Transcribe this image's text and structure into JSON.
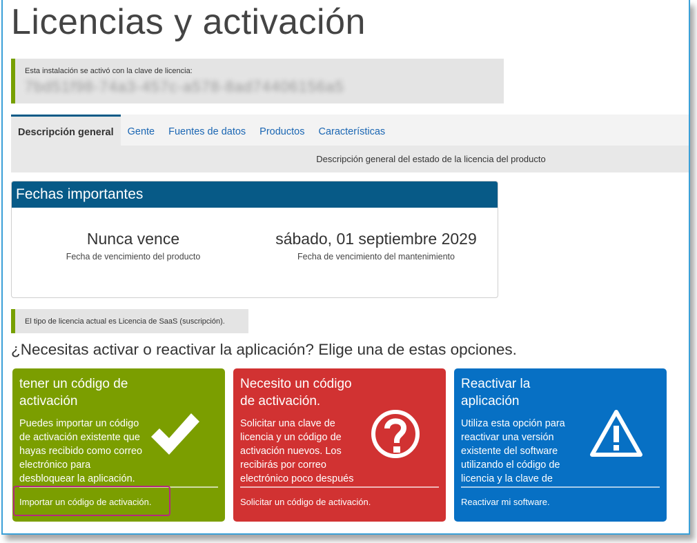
{
  "page": {
    "title": "Licencias y activación"
  },
  "license": {
    "label": "Esta instalación se activó con la clave de licencia:",
    "key": "7bd51f98-74a3-457c-a578-8ad74406156a5"
  },
  "tabs": [
    {
      "label": "Descripción general",
      "active": true
    },
    {
      "label": "Gente"
    },
    {
      "label": "Fuentes de datos"
    },
    {
      "label": "Productos"
    },
    {
      "label": "Características"
    }
  ],
  "tab_description": "Descripción general del estado de la licencia del producto",
  "dates": {
    "header": "Fechas importantes",
    "product_expiry_value": "Nunca vence",
    "product_expiry_label": "Fecha de vencimiento del producto",
    "maintenance_expiry_value": "sábado, 01 septiembre 2029",
    "maintenance_expiry_label": "Fecha de vencimiento del mantenimiento"
  },
  "license_type_text": "El tipo de licencia actual es Licencia de SaaS (suscripción).",
  "question": "¿Necesitas activar o reactivar la aplicación? Elige una de estas opciones.",
  "cards": [
    {
      "title": "tener un código de activación",
      "body": "Puedes importar un código de activación existente que hayas recibido como correo electrónico para desbloquear la aplicación.",
      "link": "Importar un código de activación.",
      "icon": "checkmark-icon",
      "color": "#7b9e00"
    },
    {
      "title": "Necesito un código de activación.",
      "body": "Solicitar una clave de licencia y un código de activación nuevos. Los recibirás por correo electrónico poco después",
      "link": "Solicitar un código de activación.",
      "icon": "question-circle-icon",
      "color": "#d13232"
    },
    {
      "title": "Reactivar la aplicación",
      "body": "Utiliza esta opción para reactivar una versión existente del software utilizando el código de licencia y la clave de",
      "link": "Reactivar mi software.",
      "icon": "warning-triangle-icon",
      "color": "#0770c4"
    }
  ]
}
